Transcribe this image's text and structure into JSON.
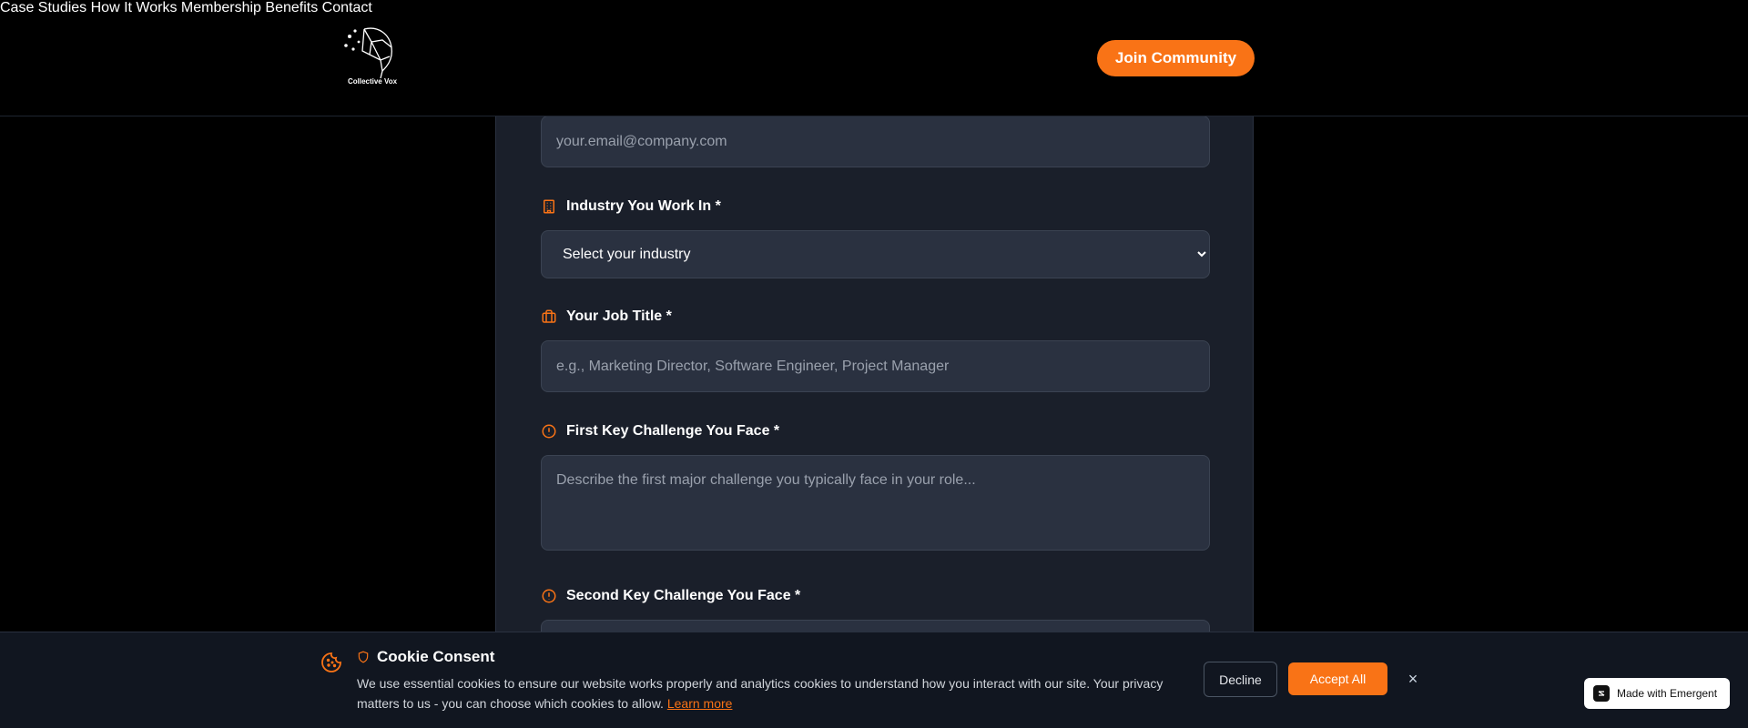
{
  "header": {
    "logo_text": "Collective Vox",
    "nav": [
      "Case Studies",
      "How It Works",
      "Membership",
      "Benefits",
      "Contact"
    ],
    "join_label": "Join Community"
  },
  "form": {
    "email": {
      "placeholder": "your.email@company.com"
    },
    "industry": {
      "label": "Industry You Work In *",
      "icon": "building-icon",
      "selected": "Select your industry"
    },
    "job_title": {
      "label": "Your Job Title *",
      "icon": "briefcase-icon",
      "placeholder": "e.g., Marketing Director, Software Engineer, Project Manager"
    },
    "challenge1": {
      "label": "First Key Challenge You Face *",
      "icon": "alert-circle-icon",
      "placeholder": "Describe the first major challenge you typically face in your role..."
    },
    "challenge2": {
      "label": "Second Key Challenge You Face *",
      "icon": "alert-circle-icon"
    }
  },
  "cookie": {
    "title": "Cookie Consent",
    "text": "We use essential cookies to ensure our website works properly and analytics cookies to understand how you interact with our site. Your privacy matters to us - you can choose which cookies to allow.",
    "learn_more": "Learn more",
    "decline": "Decline",
    "accept": "Accept All",
    "close": "×"
  },
  "badge": {
    "label": "Made with Emergent"
  },
  "colors": {
    "accent": "#f97316",
    "panel": "#1a1f2a",
    "input_bg": "#2a3140"
  }
}
